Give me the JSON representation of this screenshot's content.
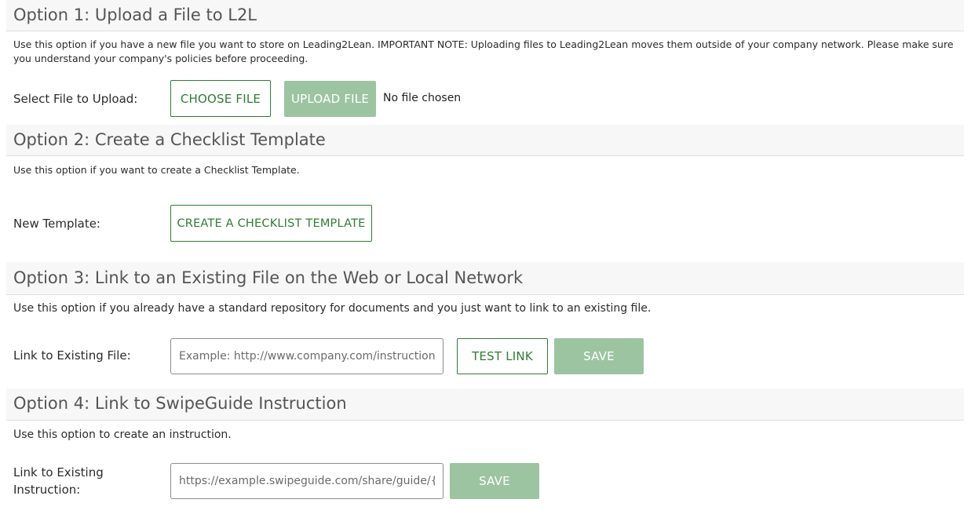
{
  "option1": {
    "title": "Option 1: Upload a File to L2L",
    "description": "Use this option if you have a new file you want to store on Leading2Lean. IMPORTANT NOTE: Uploading files to Leading2Lean moves them outside of your company network. Please make sure you understand your company's policies before proceeding.",
    "field_label": "Select File to Upload:",
    "choose_label": "CHOOSE FILE",
    "upload_label": "UPLOAD FILE",
    "file_status": "No file chosen"
  },
  "option2": {
    "title": "Option 2: Create a Checklist Template",
    "description": "Use this option if you want to create a Checklist Template.",
    "field_label": "New Template:",
    "create_label": "CREATE A CHECKLIST TEMPLATE"
  },
  "option3": {
    "title": "Option 3: Link to an Existing File on the Web or Local Network",
    "description": "Use this option if you already have a standard repository for documents and you just want to link to an existing file.",
    "field_label": "Link to Existing File:",
    "input_placeholder": "Example: http://www.company.com/instructions/file.pdf",
    "test_label": "TEST LINK",
    "save_label": "SAVE"
  },
  "option4": {
    "title": "Option 4: Link to SwipeGuide Instruction",
    "description": "Use this option to create an instruction.",
    "field_label": "Link to Existing Instruction:",
    "input_placeholder": "https://example.swipeguide.com/share/guide/{id}",
    "save_label": "SAVE"
  },
  "colors": {
    "accent": "#2e7d32",
    "disabled_button": "#9cc4a1",
    "header_bg": "#f7f7f7"
  }
}
